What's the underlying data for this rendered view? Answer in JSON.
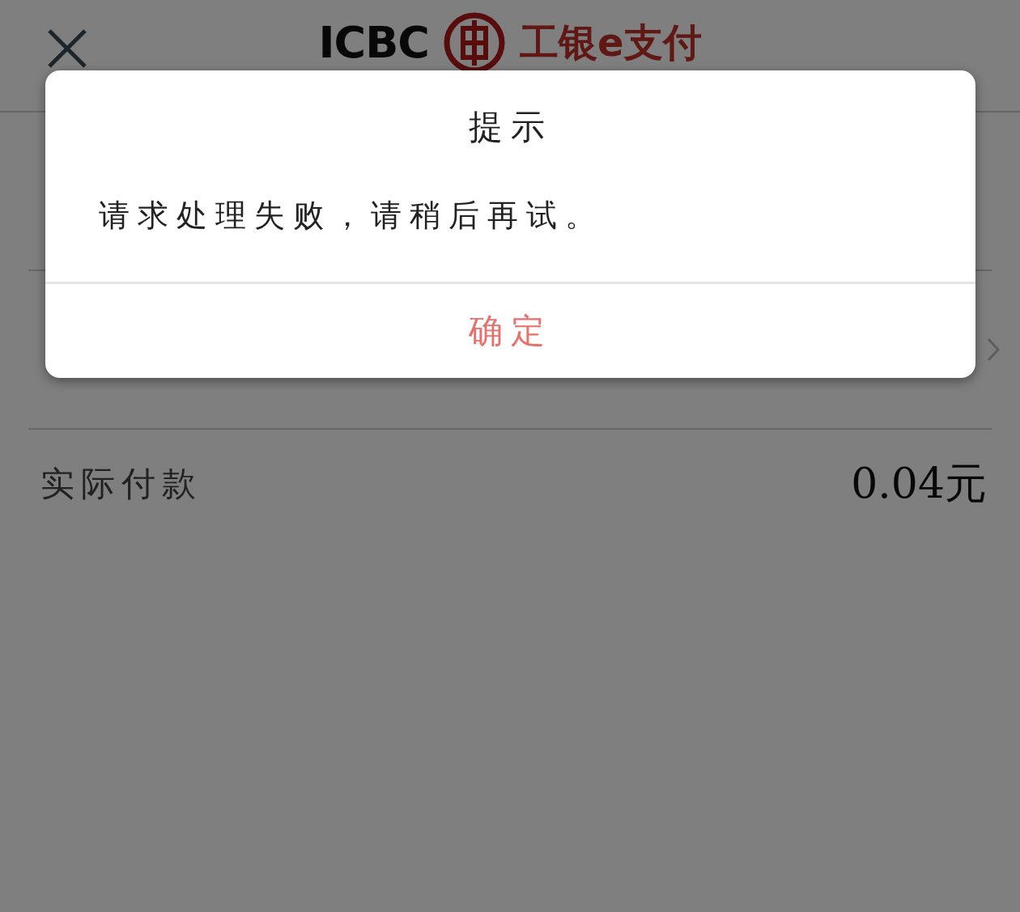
{
  "header": {
    "logo_text": "ICBC",
    "brand_text": "工银e支付"
  },
  "rows": [
    {
      "kind": "blank"
    },
    {
      "kind": "chevron"
    },
    {
      "kind": "amount",
      "label": "实际付款",
      "value": "0.04元"
    }
  ],
  "dialog": {
    "title": "提示",
    "message": "请求处理失败，请稍后再试。",
    "button": "确定"
  }
}
